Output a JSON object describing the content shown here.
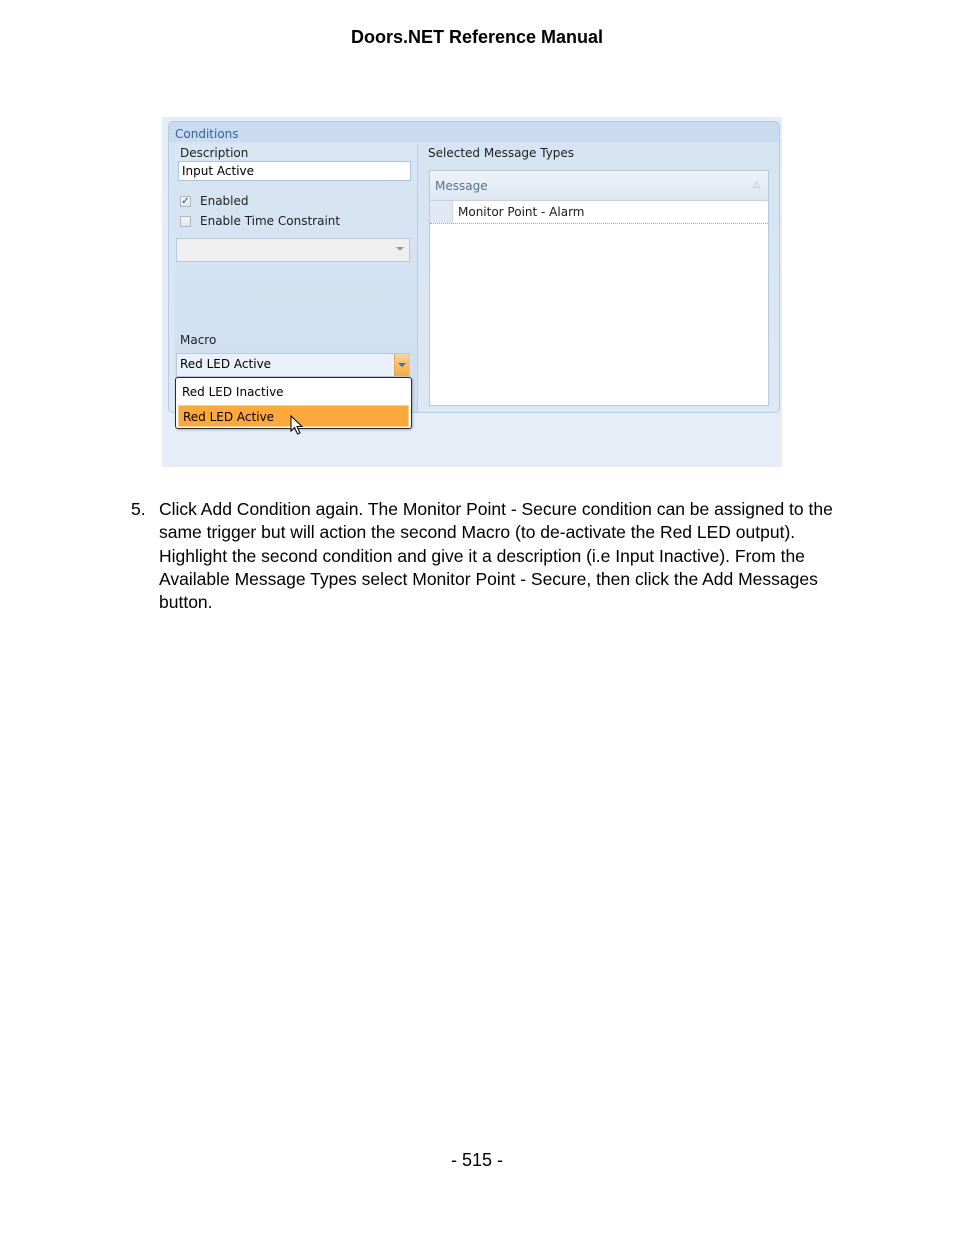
{
  "page": {
    "header": "Doors.NET Reference Manual",
    "footer": "- 515 -"
  },
  "figure": {
    "group_title": "Conditions",
    "left": {
      "description_label": "Description",
      "description_value": "Input Active",
      "enabled_label": "Enabled",
      "enabled_checked": true,
      "enabled_mark": "✓",
      "time_constraint_label": "Enable Time Constraint",
      "time_constraint_checked": false,
      "time_constraint_value": "",
      "macro_label": "Macro",
      "macro_value": "Red LED Active",
      "macro_options": [
        "Red LED Inactive",
        "Red LED Active"
      ],
      "macro_highlighted": "Red LED Active"
    },
    "right": {
      "label": "Selected Message Types",
      "column_header": "Message",
      "sort_icon": "△",
      "rows": [
        "Monitor Point - Alarm"
      ]
    },
    "colors": {
      "highlight": "#fba93d",
      "group_header": "#c9dbef",
      "title_text": "#3b5f8f"
    }
  },
  "instructions": {
    "step_number": "5.",
    "paragraph1": "Click Add Condition again. The Monitor Point - Secure condition can be assigned to the same trigger but will action the second Macro (to de-activate the Red LED output).",
    "paragraph2": "Highlight the second condition and give it a description (i.e Input Inactive). From the Available Message Types select Monitor Point - Secure, then click the Add Messages button."
  }
}
